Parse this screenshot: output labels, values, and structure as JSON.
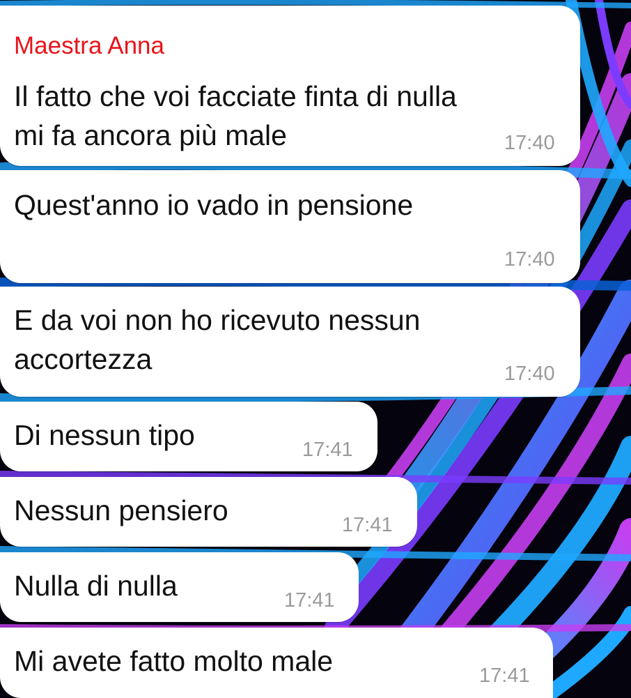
{
  "chat": {
    "sender_name": "Maestra Anna",
    "sender_color": "#e8141c",
    "bubble_color": "#ffffff",
    "messages": [
      {
        "text": "Il fatto che voi facciate finta di nulla\nmi fa ancora più male",
        "time": "17:40"
      },
      {
        "text": "Quest'anno io vado in pensione",
        "time": "17:40"
      },
      {
        "text": "E da voi non ho ricevuto nessun\naccortezza",
        "time": "17:40"
      },
      {
        "text": "Di nessun tipo",
        "time": "17:41"
      },
      {
        "text": "Nessun pensiero",
        "time": "17:41"
      },
      {
        "text": "Nulla di nulla",
        "time": "17:41"
      },
      {
        "text": "Mi avete fatto molto male",
        "time": "17:41"
      }
    ]
  },
  "wallpaper": {
    "base_color": "#05030d",
    "stripe_colors": [
      "#1fa8ff",
      "#c63ef0",
      "#7b3cff",
      "#0b60d6"
    ]
  }
}
